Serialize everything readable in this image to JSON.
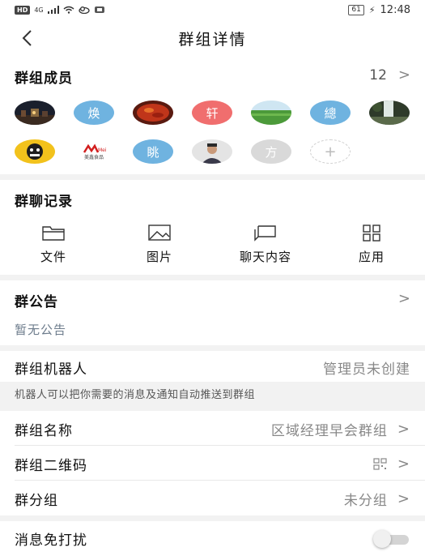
{
  "status_bar": {
    "left_badge": "HD",
    "network": "4G",
    "time": "12:48",
    "battery": "61"
  },
  "nav": {
    "back_icon": "chevron-left-icon",
    "title": "群组详情"
  },
  "members": {
    "title": "群组成员",
    "count": "12",
    "avatars": [
      {
        "type": "photo",
        "desc": "night-city"
      },
      {
        "type": "text",
        "text": "焕",
        "color": "#6fb3e0"
      },
      {
        "type": "photo",
        "desc": "food"
      },
      {
        "type": "text",
        "text": "轩",
        "color": "#f06e6e"
      },
      {
        "type": "photo",
        "desc": "green-field"
      },
      {
        "type": "text",
        "text": "總",
        "color": "#6fb3e0"
      },
      {
        "type": "photo",
        "desc": "waterfall"
      },
      {
        "type": "photo",
        "desc": "cartoon"
      },
      {
        "type": "logo",
        "text": "美鑫食品"
      },
      {
        "type": "text",
        "text": "眺",
        "color": "#6fb3e0"
      },
      {
        "type": "photo",
        "desc": "portrait"
      },
      {
        "type": "text",
        "text": "方",
        "color": "#d9d9d9"
      },
      {
        "type": "add",
        "text": "+"
      }
    ]
  },
  "chat_records": {
    "title": "群聊记录",
    "tools": [
      {
        "label": "文件",
        "icon": "folder-icon"
      },
      {
        "label": "图片",
        "icon": "image-icon"
      },
      {
        "label": "聊天内容",
        "icon": "chat-bubble-icon"
      },
      {
        "label": "应用",
        "icon": "apps-icon"
      }
    ]
  },
  "announcement": {
    "title": "群公告",
    "empty_text": "暂无公告"
  },
  "robot": {
    "label": "群组机器人",
    "value": "管理员未创建",
    "hint": "机器人可以把你需要的消息及通知自动推送到群组"
  },
  "settings": {
    "name_label": "群组名称",
    "name_value": "区域经理早会群组",
    "qr_label": "群组二维码",
    "group_label": "群分组",
    "group_value": "未分组"
  },
  "dnd": {
    "label": "消息免打扰",
    "enabled": false
  },
  "colors": {
    "accent_blue": "#6fb3e0",
    "accent_red": "#f06e6e"
  }
}
